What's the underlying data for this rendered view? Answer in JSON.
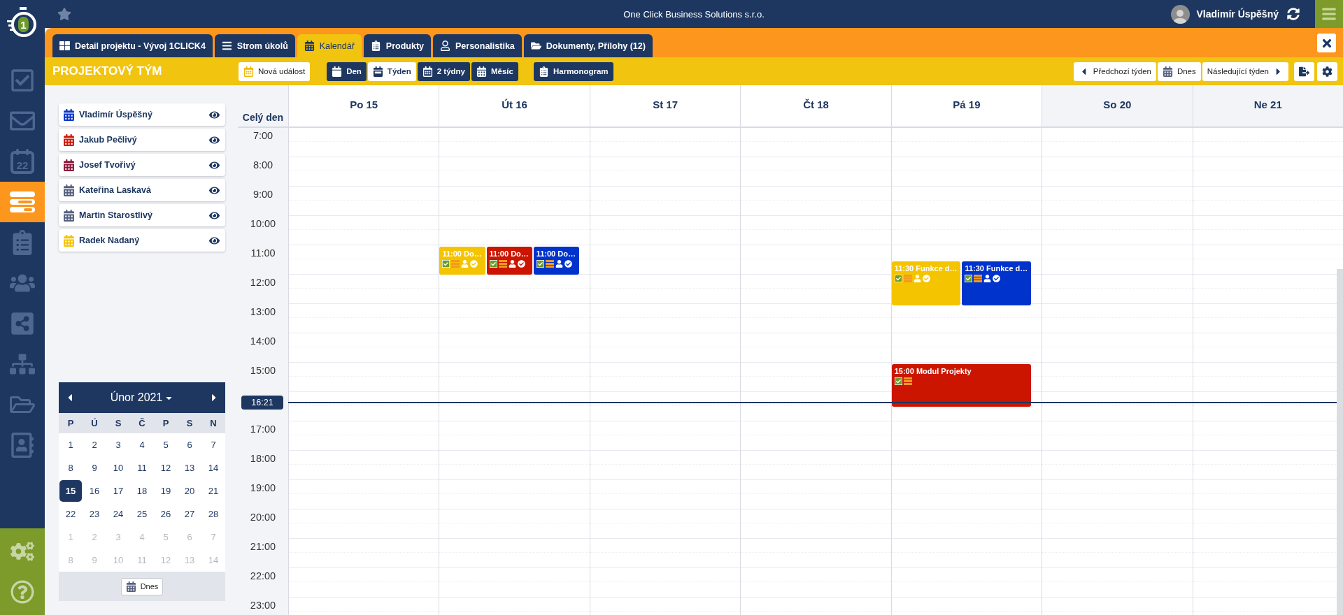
{
  "logo": {
    "text": "1"
  },
  "nav": {
    "items": [
      {
        "kind": "tasks",
        "selected": false
      },
      {
        "kind": "mail",
        "selected": false
      },
      {
        "kind": "calendar",
        "text": "22",
        "selected": false
      },
      {
        "kind": "planning",
        "selected": true
      },
      {
        "kind": "clipboard",
        "selected": false
      },
      {
        "kind": "people",
        "selected": false
      },
      {
        "kind": "share",
        "selected": false
      },
      {
        "kind": "sitemap",
        "selected": false
      },
      {
        "kind": "folder",
        "selected": false
      },
      {
        "kind": "contacts",
        "selected": false
      }
    ],
    "bottom": [
      {
        "kind": "settings"
      },
      {
        "kind": "help"
      }
    ]
  },
  "top_bar": {
    "title": "One Click Business Solutions s.r.o.",
    "user": "Vladimír Úspěšný"
  },
  "tabs": [
    {
      "kind": "grid",
      "label": "Detail projektu - Vývoj 1CLICK4",
      "selected": false
    },
    {
      "kind": "tree",
      "label": "Strom úkolů",
      "selected": false
    },
    {
      "kind": "calendar",
      "label": "Kalendář",
      "selected": true
    },
    {
      "kind": "products",
      "label": "Produkty",
      "selected": false
    },
    {
      "kind": "person",
      "label": "Personalistika",
      "selected": false
    },
    {
      "kind": "folder",
      "label": "Dokumenty, Přílohy (12)",
      "selected": false
    }
  ],
  "toolbar": {
    "title": "PROJEKTOVÝ TÝM",
    "new_event": "Nová událost",
    "views": [
      {
        "kind": "day",
        "label": "Den",
        "selected": false
      },
      {
        "kind": "week",
        "label": "Týden",
        "selected": true
      },
      {
        "kind": "two_weeks",
        "label": "2 týdny",
        "selected": false
      },
      {
        "kind": "month",
        "label": "Měsíc",
        "selected": false
      }
    ],
    "schedule": "Harmonogram",
    "previous": "Předchozí týden",
    "today": "Dnes",
    "next": "Následující týden"
  },
  "people": [
    {
      "name": "Vladimír Úspěšný",
      "color": "#0a35c8",
      "visible": true
    },
    {
      "name": "Jakub Pečlivý",
      "color": "#cc1a0a",
      "visible": true
    },
    {
      "name": "Josef Tvořivý",
      "color": "#8b1a3c",
      "visible": true
    },
    {
      "name": "Kateřina Laskavá",
      "color": "#56617f",
      "visible": true
    },
    {
      "name": "Martin Starostlivý",
      "color": "#56617f",
      "visible": true
    },
    {
      "name": "Radek Nadaný",
      "color": "#f5c400",
      "visible": true
    }
  ],
  "mini_calendar": {
    "title": "Únor 2021",
    "weekdays": [
      "P",
      "Ú",
      "S",
      "Č",
      "P",
      "S",
      "N"
    ],
    "weeks": [
      [
        {
          "d": "1",
          "muted": false,
          "selected": false
        },
        {
          "d": "2",
          "muted": false,
          "selected": false
        },
        {
          "d": "3",
          "muted": false,
          "selected": false
        },
        {
          "d": "4",
          "muted": false,
          "selected": false
        },
        {
          "d": "5",
          "muted": false,
          "selected": false
        },
        {
          "d": "6",
          "muted": false,
          "selected": false
        },
        {
          "d": "7",
          "muted": false,
          "selected": false
        }
      ],
      [
        {
          "d": "8",
          "muted": false,
          "selected": false
        },
        {
          "d": "9",
          "muted": false,
          "selected": false
        },
        {
          "d": "10",
          "muted": false,
          "selected": false
        },
        {
          "d": "11",
          "muted": false,
          "selected": false
        },
        {
          "d": "12",
          "muted": false,
          "selected": false
        },
        {
          "d": "13",
          "muted": false,
          "selected": false
        },
        {
          "d": "14",
          "muted": false,
          "selected": false
        }
      ],
      [
        {
          "d": "15",
          "muted": false,
          "selected": true
        },
        {
          "d": "16",
          "muted": false,
          "selected": false
        },
        {
          "d": "17",
          "muted": false,
          "selected": false
        },
        {
          "d": "18",
          "muted": false,
          "selected": false
        },
        {
          "d": "19",
          "muted": false,
          "selected": false
        },
        {
          "d": "20",
          "muted": false,
          "selected": false
        },
        {
          "d": "21",
          "muted": false,
          "selected": false
        }
      ],
      [
        {
          "d": "22",
          "muted": false,
          "selected": false
        },
        {
          "d": "23",
          "muted": false,
          "selected": false
        },
        {
          "d": "24",
          "muted": false,
          "selected": false
        },
        {
          "d": "25",
          "muted": false,
          "selected": false
        },
        {
          "d": "26",
          "muted": false,
          "selected": false
        },
        {
          "d": "27",
          "muted": false,
          "selected": false
        },
        {
          "d": "28",
          "muted": false,
          "selected": false
        }
      ],
      [
        {
          "d": "1",
          "muted": true,
          "selected": false
        },
        {
          "d": "2",
          "muted": true,
          "selected": false
        },
        {
          "d": "3",
          "muted": true,
          "selected": false
        },
        {
          "d": "4",
          "muted": true,
          "selected": false
        },
        {
          "d": "5",
          "muted": true,
          "selected": false
        },
        {
          "d": "6",
          "muted": true,
          "selected": false
        },
        {
          "d": "7",
          "muted": true,
          "selected": false
        }
      ],
      [
        {
          "d": "8",
          "muted": true,
          "selected": false
        },
        {
          "d": "9",
          "muted": true,
          "selected": false
        },
        {
          "d": "10",
          "muted": true,
          "selected": false
        },
        {
          "d": "11",
          "muted": true,
          "selected": false
        },
        {
          "d": "12",
          "muted": true,
          "selected": false
        },
        {
          "d": "13",
          "muted": true,
          "selected": false
        },
        {
          "d": "14",
          "muted": true,
          "selected": false
        }
      ]
    ],
    "today": "Dnes"
  },
  "calendar": {
    "all_day": "Celý den",
    "hours": [
      {
        "kind": "hour",
        "label": "7:00"
      },
      {
        "kind": "hour",
        "label": "8:00"
      },
      {
        "kind": "hour",
        "label": "9:00"
      },
      {
        "kind": "hour",
        "label": "10:00"
      },
      {
        "kind": "hour",
        "label": "11:00"
      },
      {
        "kind": "hour",
        "label": "12:00"
      },
      {
        "kind": "hour",
        "label": "13:00"
      },
      {
        "kind": "hour",
        "label": "14:00"
      },
      {
        "kind": "hour",
        "label": "15:00"
      },
      {
        "kind": "now",
        "label": "16:21"
      },
      {
        "kind": "hour",
        "label": "17:00"
      },
      {
        "kind": "hour",
        "label": "18:00"
      },
      {
        "kind": "hour",
        "label": "19:00"
      },
      {
        "kind": "hour",
        "label": "20:00"
      },
      {
        "kind": "hour",
        "label": "21:00"
      },
      {
        "kind": "hour",
        "label": "22:00"
      },
      {
        "kind": "hour",
        "label": "23:00"
      }
    ],
    "days": [
      {
        "label": "Po 15",
        "weekend": false
      },
      {
        "label": "Út 16",
        "weekend": false,
        "events": [
          {
            "title": "11:00 Do…",
            "color": "#f5c400",
            "assigned": true,
            "done": true
          },
          {
            "title": "11:00 Do…",
            "color": "#cc1500",
            "assigned": true,
            "done": true
          },
          {
            "title": "11:00 Do…",
            "color": "#0033cc",
            "assigned": true,
            "done": true
          }
        ]
      },
      {
        "label": "St 17",
        "weekend": false
      },
      {
        "label": "Čt 18",
        "weekend": false
      },
      {
        "label": "Pá 19",
        "weekend": false,
        "events": [
          {
            "title": "11:30 Funkce d…",
            "color": "#f5c400",
            "assigned": true,
            "done": true
          },
          {
            "title": "11:30 Funkce d…",
            "color": "#0033cc",
            "assigned": true,
            "done": true
          },
          {
            "title": "15:00 Modul Projekty",
            "color": "#cc1500",
            "assigned": false,
            "done": false
          }
        ]
      },
      {
        "label": "So 20",
        "weekend": true
      },
      {
        "label": "Ne 21",
        "weekend": true
      }
    ]
  }
}
